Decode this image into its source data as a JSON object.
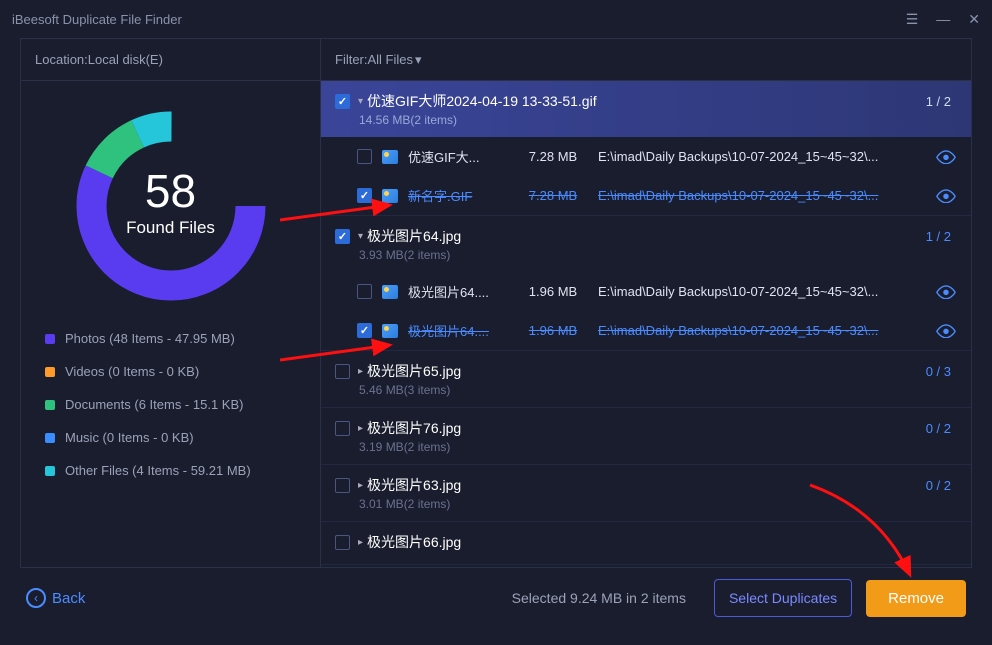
{
  "app_title": "iBeesoft Duplicate File Finder",
  "location": {
    "label": "Location:",
    "value": "Local disk(E)"
  },
  "filter": {
    "label": "Filter:",
    "value": "All Files"
  },
  "donut": {
    "count": "58",
    "label": "Found Files"
  },
  "chart_data": {
    "type": "pie",
    "title": "Found Files by Category",
    "series": [
      {
        "name": "Photos",
        "items": 48,
        "size_mb": 47.95,
        "color": "#5a3cf0"
      },
      {
        "name": "Videos",
        "items": 0,
        "size_mb": 0,
        "color": "#ff9a2b"
      },
      {
        "name": "Documents",
        "items": 6,
        "size_mb": 0.0151,
        "color": "#2ec27e"
      },
      {
        "name": "Music",
        "items": 0,
        "size_mb": 0,
        "color": "#3a8cff"
      },
      {
        "name": "Other Files",
        "items": 4,
        "size_mb": 59.21,
        "color": "#26c6da"
      }
    ]
  },
  "legend": [
    {
      "text": "Photos (48 Items - 47.95 MB)",
      "color": "#5a3cf0"
    },
    {
      "text": "Videos (0 Items - 0 KB)",
      "color": "#ff9a2b"
    },
    {
      "text": "Documents (6 Items - 15.1 KB)",
      "color": "#2ec27e"
    },
    {
      "text": "Music (0 Items - 0 KB)",
      "color": "#3a8cff"
    },
    {
      "text": "Other Files (4 Items - 59.21 MB)",
      "color": "#26c6da"
    }
  ],
  "groups": [
    {
      "checked": true,
      "expanded": true,
      "hl": true,
      "name": "优速GIF大师2024-04-19 13-33-51.gif",
      "sub": "14.56 MB(2 items)",
      "count": "1 / 2",
      "rows": [
        {
          "checked": false,
          "sel": false,
          "name": "优速GIF大...",
          "size": "7.28 MB",
          "path": "E:\\imad\\Daily Backups\\10-07-2024_15~45~32\\..."
        },
        {
          "checked": true,
          "sel": true,
          "name": "新名字.GIF",
          "size": "7.28 MB",
          "path": "E:\\imad\\Daily Backups\\10-07-2024_15~45~32\\..."
        }
      ]
    },
    {
      "checked": true,
      "expanded": true,
      "hl": false,
      "name": "极光图片64.jpg",
      "sub": "3.93 MB(2 items)",
      "count": "1 / 2",
      "rows": [
        {
          "checked": false,
          "sel": false,
          "name": "极光图片64....",
          "size": "1.96 MB",
          "path": "E:\\imad\\Daily Backups\\10-07-2024_15~45~32\\..."
        },
        {
          "checked": true,
          "sel": true,
          "name": "极光图片64....",
          "size": "1.96 MB",
          "path": "E:\\imad\\Daily Backups\\10-07-2024_15~45~32\\..."
        }
      ]
    },
    {
      "checked": false,
      "expanded": false,
      "hl": false,
      "name": "极光图片65.jpg",
      "sub": "5.46 MB(3 items)",
      "count": "0 / 3",
      "rows": []
    },
    {
      "checked": false,
      "expanded": false,
      "hl": false,
      "name": "极光图片76.jpg",
      "sub": "3.19 MB(2 items)",
      "count": "0 / 2",
      "rows": []
    },
    {
      "checked": false,
      "expanded": false,
      "hl": false,
      "name": "极光图片63.jpg",
      "sub": "3.01 MB(2 items)",
      "count": "0 / 2",
      "rows": []
    },
    {
      "checked": false,
      "expanded": false,
      "hl": false,
      "name": "极光图片66.jpg",
      "sub": "",
      "count": "",
      "rows": []
    }
  ],
  "footer": {
    "back": "Back",
    "summary": "Selected 9.24 MB in 2 items",
    "select_dup": "Select Duplicates",
    "remove": "Remove"
  }
}
